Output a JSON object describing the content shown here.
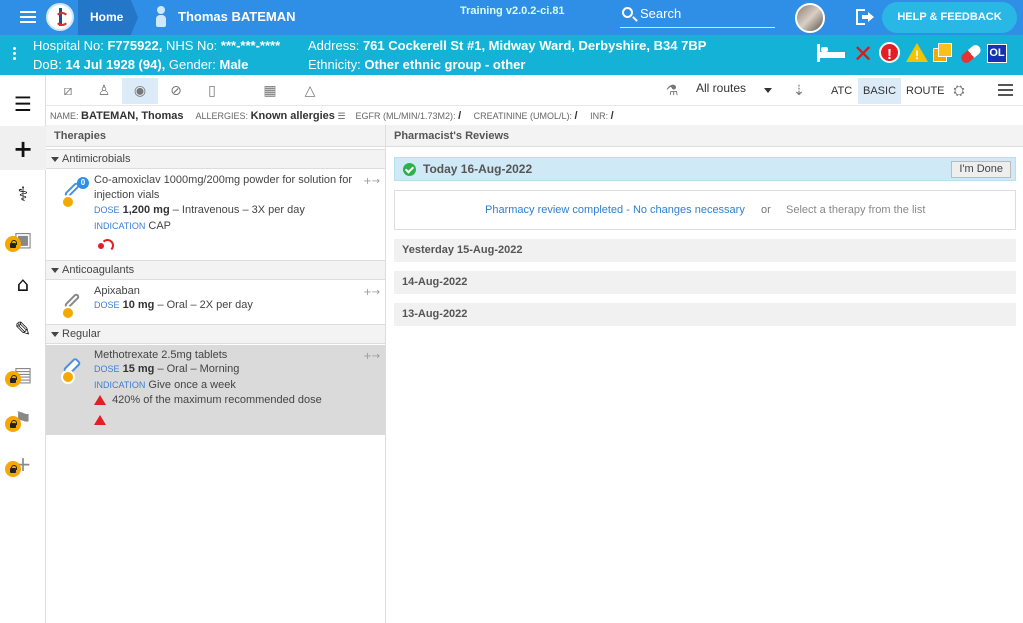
{
  "topbar": {
    "home_label": "Home",
    "patient_name": "Thomas BATEMAN",
    "version": "Training v2.0.2-ci.81",
    "search_label": "Search",
    "help_label": "HELP & FEEDBACK"
  },
  "patient": {
    "hospital_no_label": "Hospital No:",
    "hospital_no": "F775922,",
    "nhs_label": "NHS No:",
    "nhs_no": "***-***-****",
    "dob_label": "DoB:",
    "dob": "14 Jul 1928 (94),",
    "gender_label": "Gender:",
    "gender": "Male",
    "address_label": "Address:",
    "address": "761 Cockerell St #1, Midway Ward, Derbyshire, B34 7BP",
    "ethnicity_label": "Ethnicity:",
    "ethnicity": "Other ethnic group - other",
    "alerts": [
      "bed-icon",
      "x-icon",
      "exclamation-icon",
      "warning-icon",
      "copy-icon",
      "pill-icon",
      "ol-badge"
    ],
    "ol_label": "OL"
  },
  "leftnav": {
    "items": [
      "list-icon",
      "plus-icon",
      "stethoscope-icon",
      "camera-icon",
      "home-icon",
      "edit-icon",
      "clipboard-icon",
      "walk-icon",
      "add-icon"
    ]
  },
  "toolbar": {
    "routes_label": "All routes",
    "atc_label": "ATC",
    "basic_label": "BASIC",
    "route_label": "ROUTE"
  },
  "infobar": {
    "name_label": "NAME:",
    "name": "BATEMAN, Thomas",
    "allergies_label": "ALLERGIES:",
    "allergies": "Known allergies",
    "egfr_label": "EGFR (ML/MIN/1.73M2):",
    "egfr": "/",
    "creatinine_label": "CREATININE (UMOL/L):",
    "creatinine": "/",
    "inr_label": "INR:",
    "inr": "/"
  },
  "therapies": {
    "header": "Therapies",
    "groups": [
      {
        "name": "Antimicrobials"
      },
      {
        "name": "Anticoagulants"
      },
      {
        "name": "Regular"
      }
    ],
    "items": [
      {
        "name": "Co-amoxiclav 1000mg/200mg powder for solution for injection vials",
        "count": "0",
        "dose_label": "DOSE",
        "dose": "1,200 mg",
        "route": "– Intravenous – 3X per day",
        "indication_label": "INDICATION",
        "indication": "CAP"
      },
      {
        "name": "Apixaban",
        "dose_label": "DOSE",
        "dose": "10 mg",
        "route": "– Oral – 2X per day"
      },
      {
        "name": "Methotrexate 2.5mg tablets",
        "dose_label": "DOSE",
        "dose": "15 mg",
        "route": "– Oral – Morning",
        "indication_label": "INDICATION",
        "indication": "Give once a week",
        "warning": "420% of the maximum recommended dose"
      }
    ]
  },
  "reviews": {
    "header": "Pharmacist's Reviews",
    "today": "Today 16-Aug-2022",
    "done_label": "I'm Done",
    "completed_link": "Pharmacy review completed - No changes necessary",
    "or": "or",
    "select_hint": "Select a therapy from the list",
    "days": [
      "Yesterday 15-Aug-2022",
      "14-Aug-2022",
      "13-Aug-2022"
    ]
  }
}
